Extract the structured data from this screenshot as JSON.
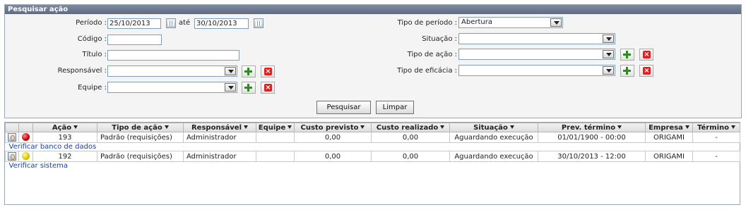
{
  "panel": {
    "title": "Pesquisar ação"
  },
  "form": {
    "periodo_label": "Período :",
    "periodo_from": "25/10/2013",
    "ate_label": "até",
    "periodo_to": "30/10/2013",
    "codigo_label": "Código :",
    "codigo_value": "",
    "titulo_label": "Título :",
    "titulo_value": "",
    "responsavel_label": "Responsável :",
    "responsavel_value": "",
    "equipe_label": "Equipe :",
    "equipe_value": "",
    "tipo_periodo_label": "Tipo de período :",
    "tipo_periodo_value": "Abertura",
    "situacao_label": "Situação :",
    "situacao_value": "",
    "tipo_acao_label": "Tipo de ação :",
    "tipo_acao_value": "",
    "tipo_eficacia_label": "Tipo de eficácia :",
    "tipo_eficacia_value": ""
  },
  "buttons": {
    "search": "Pesquisar",
    "clear": "Limpar"
  },
  "grid": {
    "columns": [
      "Ação",
      "Tipo de ação",
      "Responsável",
      "Equipe",
      "Custo previsto",
      "Custo realizado",
      "Situação",
      "Prev. término",
      "Empresa",
      "Término"
    ],
    "rows": [
      {
        "status_icon": "red-status-icon",
        "acao": "193",
        "tipo": "Padrão (requisições)",
        "responsavel": "Administrador",
        "equipe": "",
        "custo_previsto": "0,00",
        "custo_realizado": "0,00",
        "situacao": "Aguardando execução",
        "prev_termino": "01/01/1900 - 00:00",
        "empresa": "ORIGAMI",
        "termino": "-",
        "description": "Verificar banco de dados"
      },
      {
        "status_icon": "yellow-status-icon",
        "acao": "192",
        "tipo": "Padrão (requisições)",
        "responsavel": "Administrador",
        "equipe": "",
        "custo_previsto": "0,00",
        "custo_realizado": "0,00",
        "situacao": "Aguardando execução",
        "prev_termino": "30/10/2013 - 12:00",
        "empresa": "ORIGAMI",
        "termino": "-",
        "description": "Verificar sistema"
      }
    ]
  }
}
